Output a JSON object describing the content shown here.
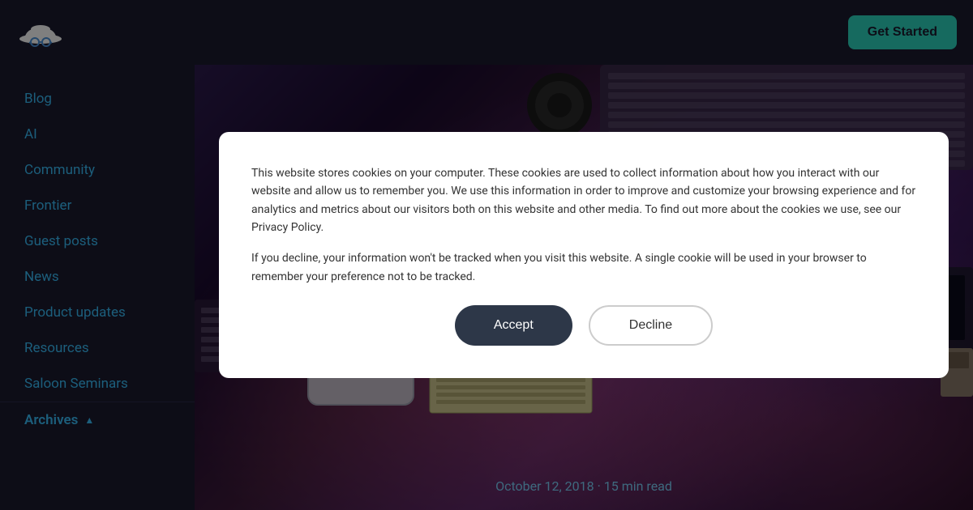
{
  "header": {
    "logo_alt": "Cowboy hat logo",
    "get_started_label": "Get Started"
  },
  "sidebar": {
    "items": [
      {
        "id": "blog",
        "label": "Blog"
      },
      {
        "id": "ai",
        "label": "AI"
      },
      {
        "id": "community",
        "label": "Community"
      },
      {
        "id": "frontier",
        "label": "Frontier"
      },
      {
        "id": "guest-posts",
        "label": "Guest posts"
      },
      {
        "id": "news",
        "label": "News"
      },
      {
        "id": "product-updates",
        "label": "Product updates"
      },
      {
        "id": "resources",
        "label": "Resources"
      },
      {
        "id": "saloon-seminars",
        "label": "Saloon Seminars"
      }
    ],
    "archives": {
      "label": "Archives",
      "chevron": "▲"
    }
  },
  "hero": {
    "date": "October 12, 2018",
    "read_time": "15 min read",
    "separator": "·"
  },
  "cookie_modal": {
    "paragraph1": "This website stores cookies on your computer. These cookies are used to collect information about how you interact with our website and allow us to remember you. We use this information in order to improve and customize your browsing experience and for analytics and metrics about our visitors both on this website and other media. To find out more about the cookies we use, see our Privacy Policy.",
    "paragraph2": "If you decline, your information won't be tracked when you visit this website. A single cookie will be used in your browser to remember your preference not to be tracked.",
    "accept_label": "Accept",
    "decline_label": "Decline"
  }
}
